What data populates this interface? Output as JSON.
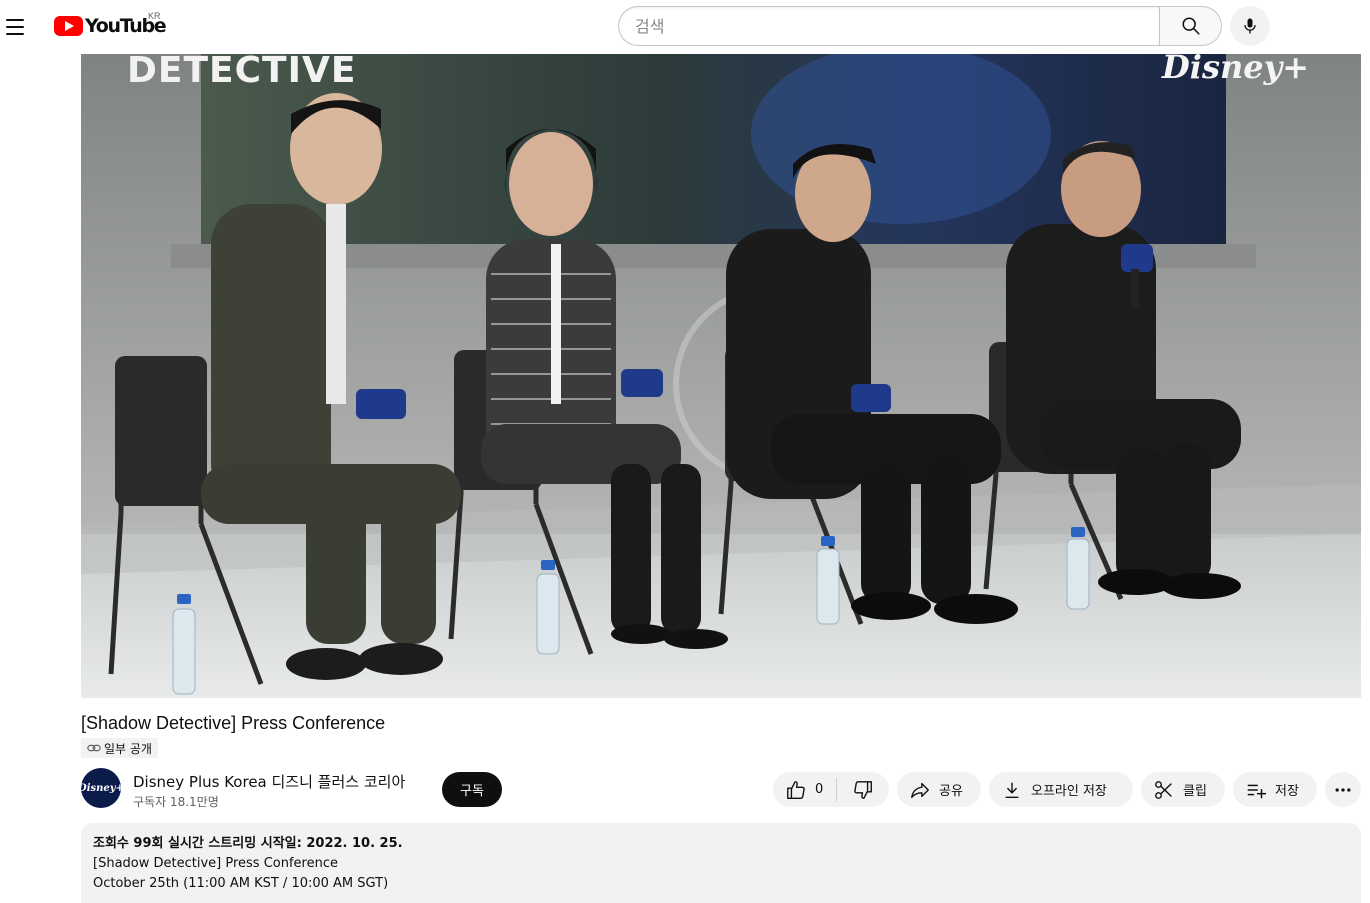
{
  "masthead": {
    "logo_text": "YouTube",
    "region": "KR",
    "search_placeholder": "검색"
  },
  "player": {
    "overlay_title": "DETECTIVE",
    "overlay_brand": "Disney+"
  },
  "video": {
    "title": "[Shadow Detective] Press Conference",
    "privacy": "일부 공개"
  },
  "channel": {
    "avatar_text": "Disney+",
    "name": "Disney Plus Korea 디즈니 플러스 코리아",
    "subscribers": "구독자 18.1만명",
    "subscribe_label": "구독"
  },
  "actions": {
    "like_count": "0",
    "share_label": "공유",
    "download_label": "오프라인 저장",
    "clip_label": "클립",
    "save_label": "저장"
  },
  "description": {
    "meta": "조회수 99회  실시간 스트리밍 시작일: 2022. 10. 25.",
    "line1": "[Shadow Detective] Press Conference",
    "line2": "October 25th (11:00 AM KST / 10:00 AM SGT)"
  },
  "colors": {
    "brand_red": "#ff0000",
    "subscribe_bg": "#0f0f0f",
    "pill_bg": "#f2f2f2"
  }
}
